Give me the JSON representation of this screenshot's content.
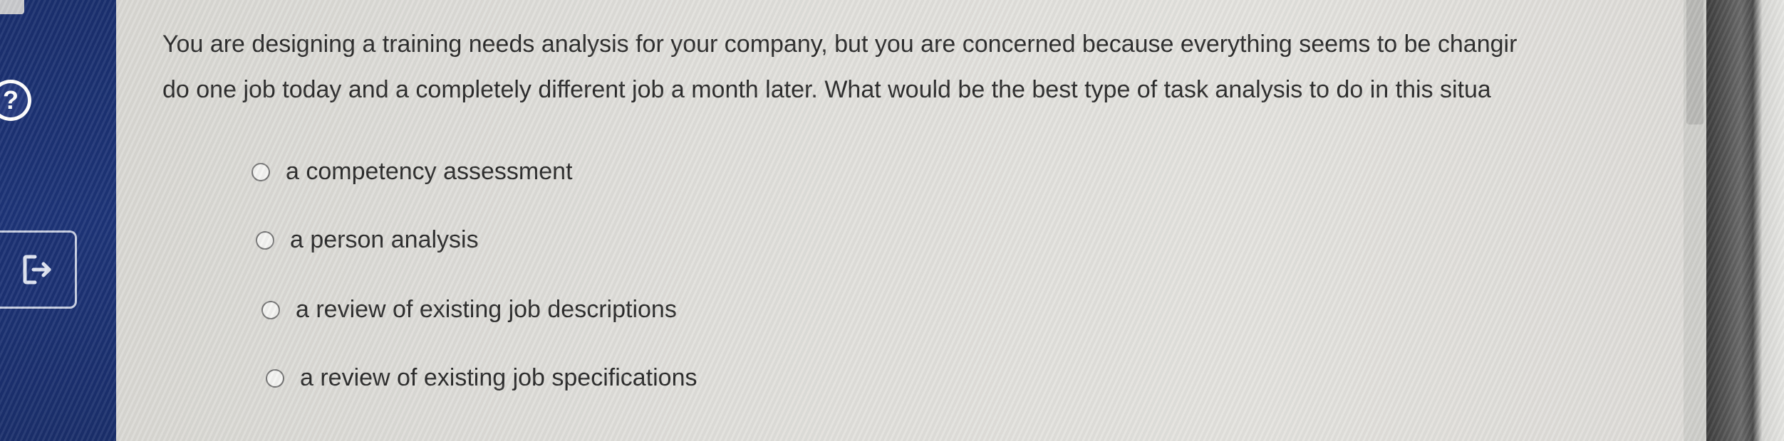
{
  "question": {
    "line1": "You are designing a training needs analysis for your company, but you are concerned because everything seems to be changir",
    "line2": "do one job today and a completely different job a month later. What would be the best type of task analysis to do in this situa"
  },
  "options": [
    {
      "label": "a competency assessment",
      "selected": false
    },
    {
      "label": "a person analysis",
      "selected": false
    },
    {
      "label": "a review of existing job descriptions",
      "selected": false
    },
    {
      "label": "a review of existing job specifications",
      "selected": false
    }
  ],
  "sidebar": {
    "help_icon": "question-mark-icon",
    "help_symbol": "?",
    "exit_icon": "exit-arrow-icon"
  },
  "colors": {
    "sidebar_bg": "#1a2f6e",
    "content_bg": "#e1e0dc",
    "text": "#2b2b2b"
  }
}
